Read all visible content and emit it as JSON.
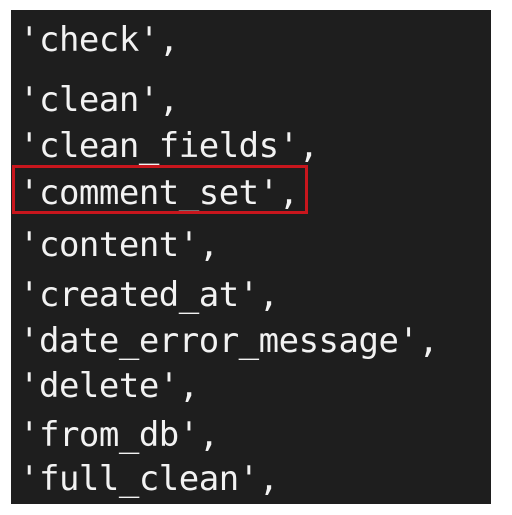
{
  "colors": {
    "background": "#1e1e1e",
    "text": "#f2f2f2",
    "highlight_border": "#c8161d"
  },
  "lines": [
    "'check',",
    "'clean',",
    "'clean_fields',",
    "'comment_set',",
    "'content',",
    "'created_at',",
    "'date_error_message',",
    "'delete',",
    "'from_db',",
    "'full_clean',"
  ],
  "highlighted_line": "'comment_set',"
}
